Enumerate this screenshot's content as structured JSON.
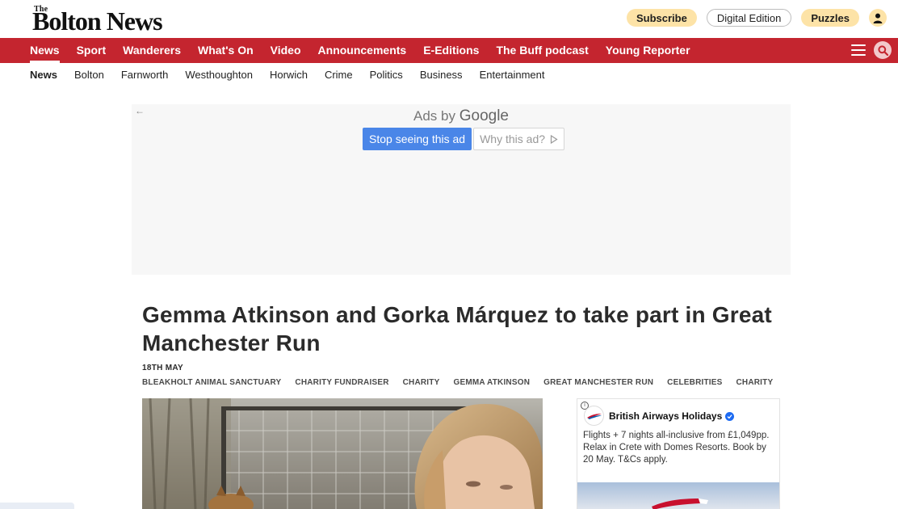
{
  "masthead": {
    "logo_the": "The",
    "logo_main": "Bolton News",
    "subscribe_label": "Subscribe",
    "digital_label": "Digital Edition",
    "puzzles_label": "Puzzles"
  },
  "main_nav": [
    "News",
    "Sport",
    "Wanderers",
    "What's On",
    "Video",
    "Announcements",
    "E-Editions",
    "The Buff podcast",
    "Young Reporter"
  ],
  "sub_nav": [
    "News",
    "Bolton",
    "Farnworth",
    "Westhoughton",
    "Horwich",
    "Crime",
    "Politics",
    "Business",
    "Entertainment"
  ],
  "ad": {
    "ads_by": "Ads by",
    "google": "Google",
    "stop_label": "Stop seeing this ad",
    "why_label": "Why this ad?"
  },
  "article": {
    "headline": "Gemma Atkinson and Gorka Márquez to take part in Great Manchester Run",
    "date": "18TH MAY",
    "tags": [
      "BLEAKHOLT ANIMAL SANCTUARY",
      "CHARITY FUNDRAISER",
      "CHARITY",
      "GEMMA ATKINSON",
      "GREAT MANCHESTER RUN",
      "CELEBRITIES",
      "CHARITY"
    ]
  },
  "side_ad": {
    "advertiser": "British Airways Holidays",
    "text": "Flights + 7 nights all-inclusive from £1,049pp. Relax in Crete with Domes Resorts. Book by 20 May. T&Cs apply."
  },
  "colors": {
    "brand_red": "#c4252f",
    "pill_yellow": "#fde3a7",
    "ad_blue": "#4a86e8"
  }
}
